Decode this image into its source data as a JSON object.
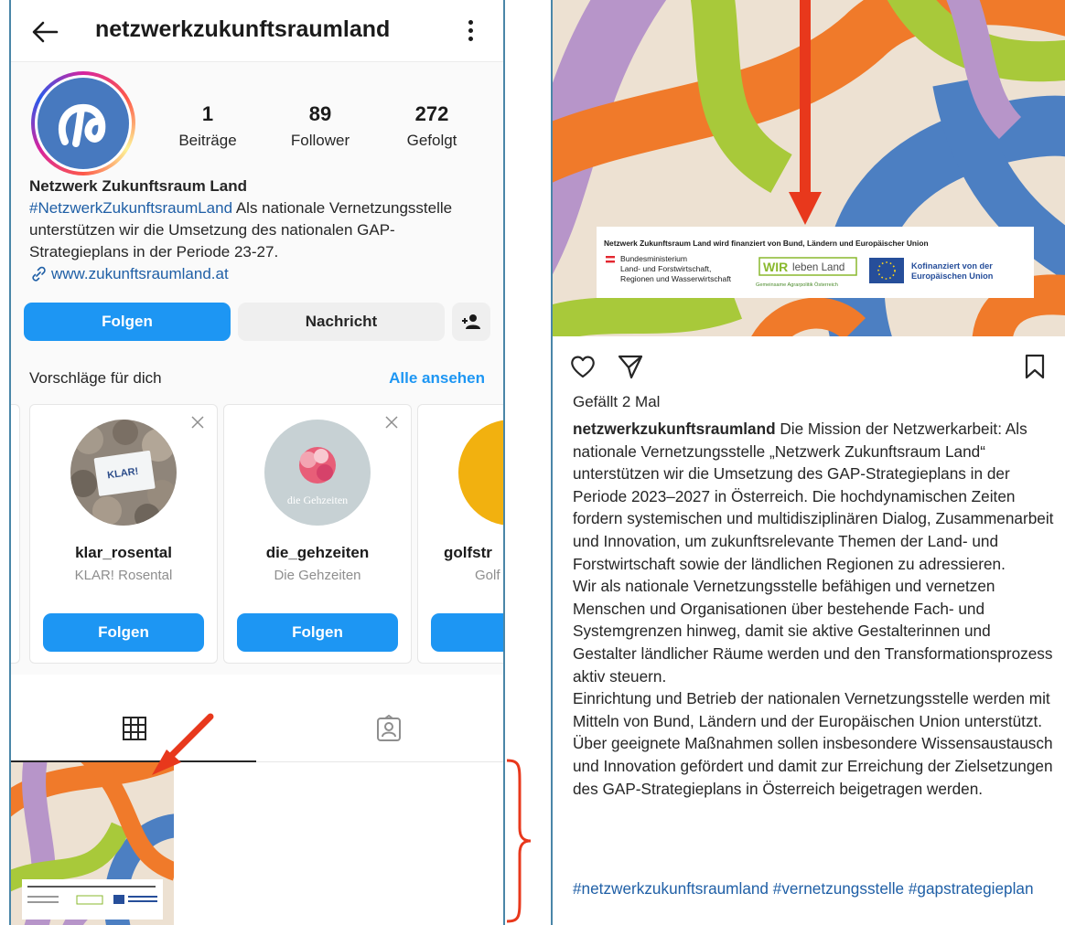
{
  "profile": {
    "username": "netzwerkzukunftsraumland",
    "stats": [
      {
        "value": "1",
        "label": "Beiträge"
      },
      {
        "value": "89",
        "label": "Follower"
      },
      {
        "value": "272",
        "label": "Gefolgt"
      }
    ],
    "display_name": "Netzwerk Zukunftsraum Land",
    "bio_hashtag": "#NetzwerkZukunftsraumLand",
    "bio_text": " Als nationale Vernetzungsstelle unterstützen wir die Umsetzung des nationalen GAP-Strategieplans in der Periode 23-27.",
    "website": "www.zukunftsraumland.at",
    "buttons": {
      "follow": "Folgen",
      "message": "Nachricht"
    }
  },
  "suggestions": {
    "title": "Vorschläge für dich",
    "see_all": "Alle ansehen",
    "cards": [
      {
        "username": "klar_rosental",
        "real_name": "KLAR! Rosental",
        "button": "Folgen",
        "pic_text": "KLAR!"
      },
      {
        "username": "die_gehzeiten",
        "real_name": "Die Gehzeiten",
        "button": "Folgen",
        "pic_text": "die Gehzeiten"
      },
      {
        "username": "golfstr",
        "real_name": "Golf",
        "button": "Fo"
      }
    ]
  },
  "post": {
    "likes": "Gefällt 2 Mal",
    "author": "netzwerkzukunftsraumland",
    "caption": " Die Mission der Netzwerkarbeit: Als nationale Vernetzungsstelle „Netzwerk Zukunftsraum Land“ unterstützen wir die Umsetzung des GAP-Strategieplans in der Periode 2023–2027 in Österreich. Die hochdynamischen Zeiten fordern systemischen und multidisziplinären Dialog, Zusammenarbeit und Innovation, um zukunftsrelevante Themen der Land- und Forstwirtschaft sowie der ländlichen Regionen zu adressieren.\nWir als nationale Vernetzungsstelle befähigen und vernetzen Menschen und Organisationen über bestehende Fach- und Systemgrenzen hinweg, damit sie aktive Gestalterinnen und Gestalter ländlicher Räume werden und den Transformationsprozess aktiv steuern.\nEinrichtung und Betrieb der nationalen Vernetzungsstelle werden mit Mitteln von Bund, Ländern und der Europäischen Union unterstützt. Über geeignete Maßnahmen sollen insbesondere Wissensaustausch und Innovation gefördert und damit zur Erreichung der Zielsetzungen des GAP-Strategieplans in Österreich beigetragen werden.",
    "hashtags": "#netzwerkzukunftsraumland #vernetzungsstelle #gapstrategieplan",
    "banner": {
      "headline": "Netzwerk Zukunftsraum Land wird finanziert von Bund, Ländern und Europäischer Union",
      "ministry_1": "Bundesministerium",
      "ministry_2": "Land- und Forstwirtschaft,",
      "ministry_3": "Regionen und Wasserwirtschaft",
      "wir": "WIR",
      "leben_land": "leben Land",
      "gap": "Gemeinsame Agrarpolitik Österreich",
      "eu_1": "Kofinanziert von der",
      "eu_2": "Europäischen Union"
    }
  },
  "colors": {
    "accent": "#1d96f3",
    "link": "#1f5fa6",
    "annotation": "#e8381c",
    "panel_border": "#4a86a8"
  }
}
